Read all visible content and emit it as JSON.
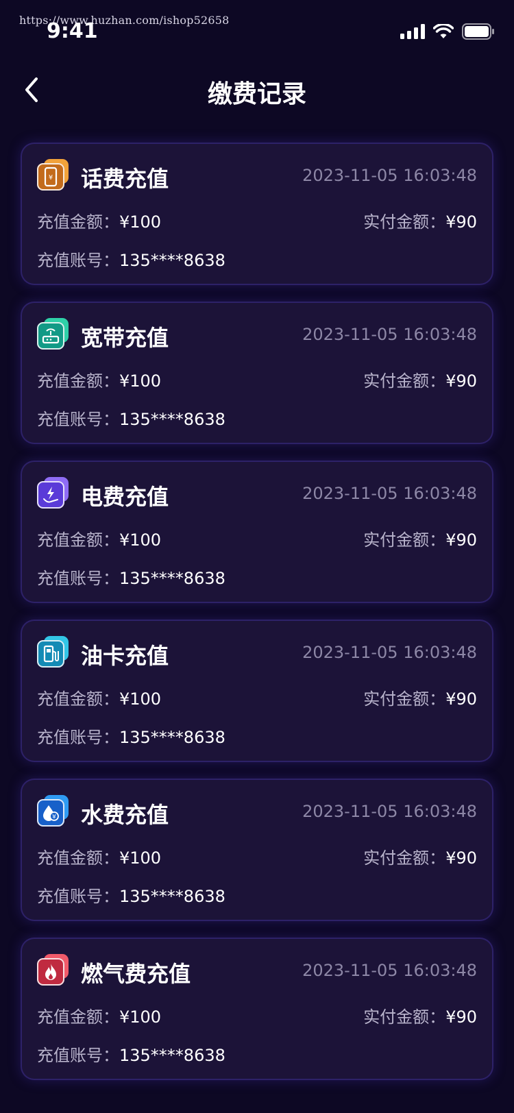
{
  "watermark": "https://www.huzhan.com/ishop52658",
  "status_bar": {
    "time": "9:41"
  },
  "nav": {
    "title": "缴费记录"
  },
  "labels": {
    "recharge_amount": "充值金额：",
    "paid_amount": "实付金额：",
    "account": "充值账号："
  },
  "records": [
    {
      "title": "话费充值",
      "time": "2023-11-05 16:03:48",
      "amount": "¥100",
      "paid": "¥90",
      "account": "135****8638",
      "icon": "phone-recharge-icon",
      "color_back": "#f1a23a",
      "color_front": "#c36b1b"
    },
    {
      "title": "宽带充值",
      "time": "2023-11-05 16:03:48",
      "amount": "¥100",
      "paid": "¥90",
      "account": "135****8638",
      "icon": "broadband-router-icon",
      "color_back": "#2fd0a8",
      "color_front": "#129a86"
    },
    {
      "title": "电费充值",
      "time": "2023-11-05 16:03:48",
      "amount": "¥100",
      "paid": "¥90",
      "account": "135****8638",
      "icon": "electricity-bolt-icon",
      "color_back": "#8f6cf5",
      "color_front": "#5a3bd8"
    },
    {
      "title": "油卡充值",
      "time": "2023-11-05 16:03:48",
      "amount": "¥100",
      "paid": "¥90",
      "account": "135****8638",
      "icon": "fuel-pump-icon",
      "color_back": "#33c6e6",
      "color_front": "#138bb5"
    },
    {
      "title": "水费充值",
      "time": "2023-11-05 16:03:48",
      "amount": "¥100",
      "paid": "¥90",
      "account": "135****8638",
      "icon": "water-drop-icon",
      "color_back": "#2f9bf2",
      "color_front": "#1760c9"
    },
    {
      "title": "燃气费充值",
      "time": "2023-11-05 16:03:48",
      "amount": "¥100",
      "paid": "¥90",
      "account": "135****8638",
      "icon": "gas-flame-icon",
      "color_back": "#f05a6a",
      "color_front": "#c02a40"
    }
  ]
}
